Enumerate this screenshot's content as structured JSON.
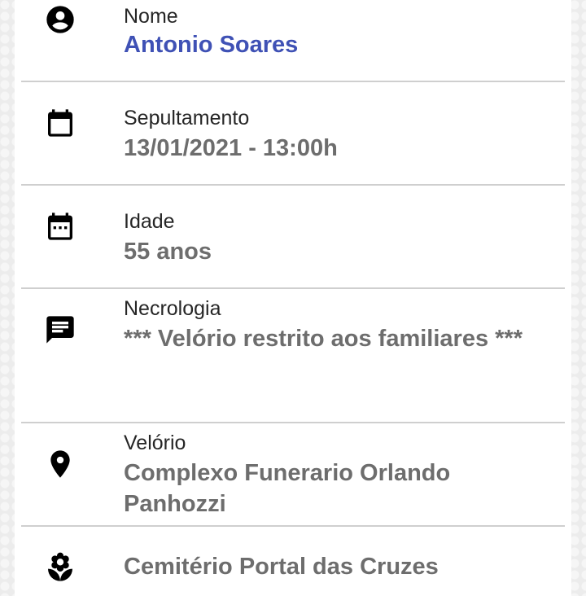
{
  "fields": [
    {
      "label": "Nome",
      "value": "Antonio Soares",
      "icon": "account-circle-icon"
    },
    {
      "label": "Sepultamento",
      "value": "13/01/2021 - 13:00h",
      "icon": "calendar-icon"
    },
    {
      "label": "Idade",
      "value": "55 anos",
      "icon": "calendar-dots-icon"
    },
    {
      "label": "Necrologia",
      "value": "*** Velório restrito aos familiares ***",
      "icon": "message-icon"
    },
    {
      "label": "Velório",
      "value": "Complexo Funerario Orlando Panhozzi",
      "icon": "location-pin-icon"
    },
    {
      "label": "",
      "value": "Cemitério Portal das Cruzes",
      "icon": "flower-icon"
    }
  ],
  "colors": {
    "name_value": "#3f51b5",
    "value": "#6d6d6d",
    "label": "#262626",
    "divider": "#cfcfcf"
  }
}
